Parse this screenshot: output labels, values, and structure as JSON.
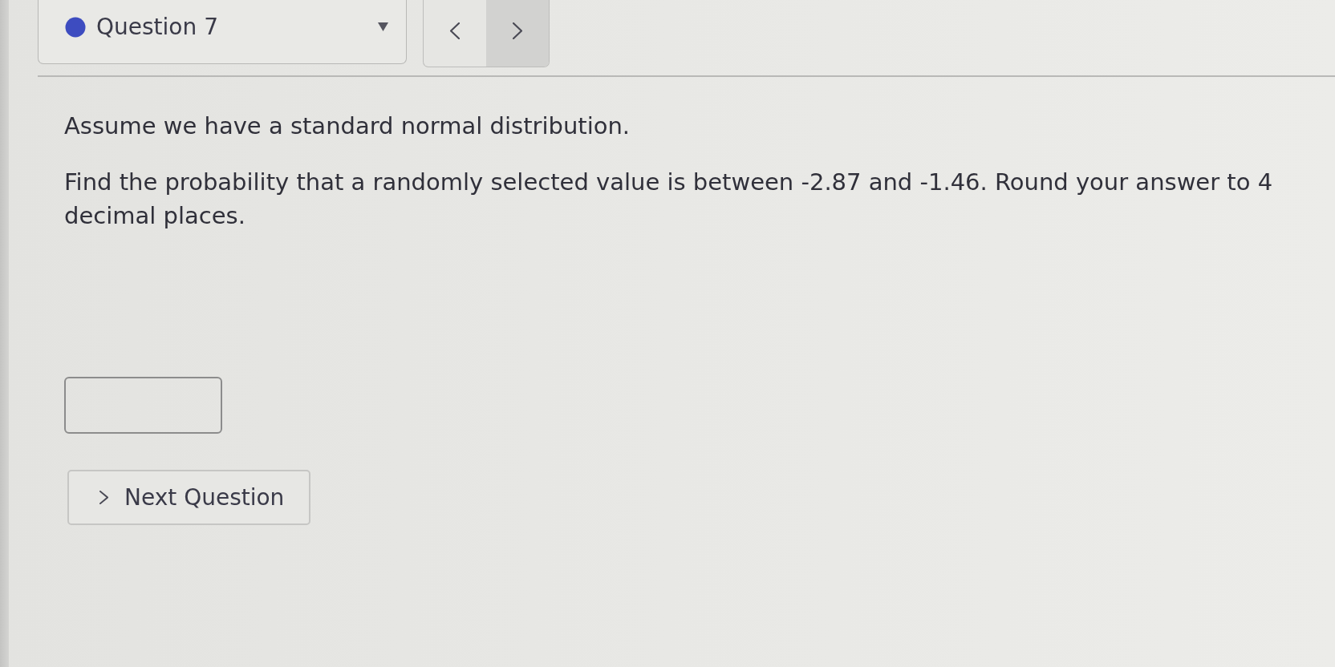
{
  "question_selector": {
    "label": "Question 7"
  },
  "question": {
    "paragraphs": [
      "Assume we have a standard normal distribution.",
      "Find the probability that a randomly selected value is between -2.87 and -1.46. Round your answer to 4 decimal places."
    ]
  },
  "next_button": {
    "label": "Next Question"
  }
}
